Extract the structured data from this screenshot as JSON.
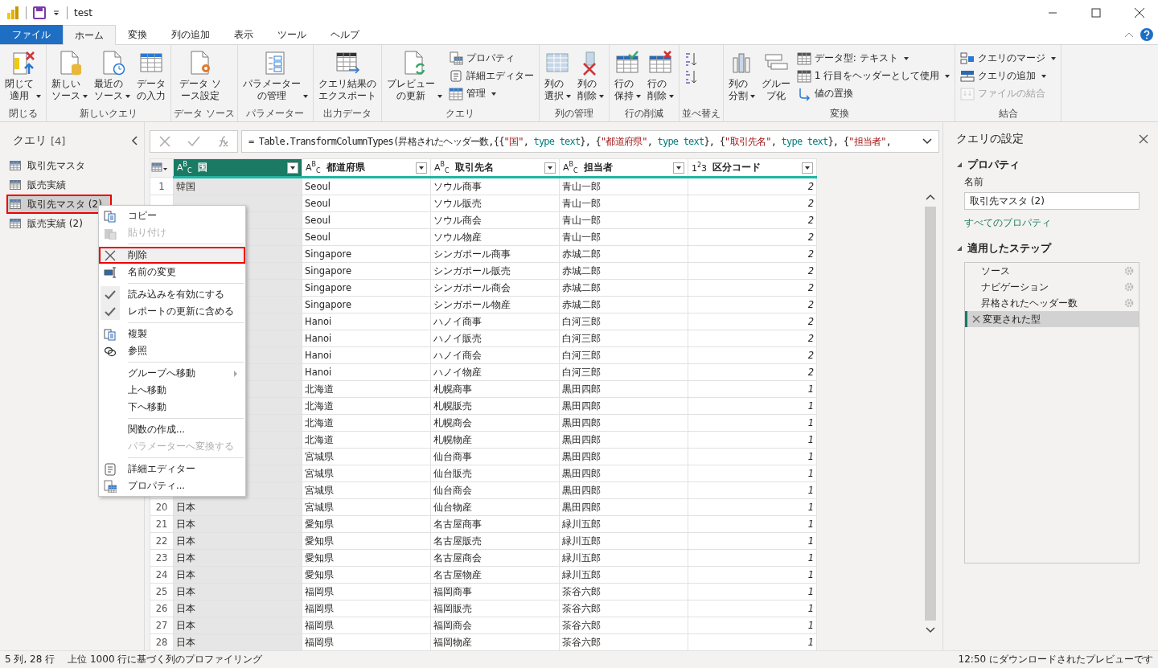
{
  "window": {
    "title": "test"
  },
  "tabs": [
    {
      "label": "ファイル",
      "kind": "file",
      "selected": false
    },
    {
      "label": "ホーム",
      "kind": "tab",
      "selected": true
    },
    {
      "label": "変換",
      "kind": "tab",
      "selected": false
    },
    {
      "label": "列の追加",
      "kind": "tab",
      "selected": false
    },
    {
      "label": "表示",
      "kind": "tab",
      "selected": false
    },
    {
      "label": "ツール",
      "kind": "tab",
      "selected": false
    },
    {
      "label": "ヘルプ",
      "kind": "tab",
      "selected": false
    }
  ],
  "ribbon": [
    {
      "label": "閉じる",
      "items": [
        {
          "kind": "large",
          "label": "閉じて適用",
          "menu": true
        }
      ]
    },
    {
      "label": "新しいクエリ",
      "items": [
        {
          "kind": "large",
          "label": "新しいソース",
          "menu": true
        },
        {
          "kind": "large",
          "label": "最近のソース",
          "menu": true
        },
        {
          "kind": "large",
          "label": "データの入力",
          "menu": false
        }
      ]
    },
    {
      "label": "データ ソース",
      "items": [
        {
          "kind": "large",
          "label": "データ ソース設定",
          "menu": false
        }
      ]
    },
    {
      "label": "パラメーター",
      "items": [
        {
          "kind": "large",
          "label": "パラメーターの管理",
          "menu": true
        }
      ]
    },
    {
      "label": "出力データ",
      "items": [
        {
          "kind": "large",
          "label": "クエリ結果のエクスポート",
          "menu": false
        }
      ]
    },
    {
      "label": "クエリ",
      "items": [
        {
          "kind": "large",
          "label": "プレビューの更新",
          "menu": true
        },
        {
          "kind": "stack",
          "items": [
            {
              "label": "プロパティ",
              "menu": false,
              "disabled": false
            },
            {
              "label": "詳細エディター",
              "menu": false,
              "disabled": false
            },
            {
              "label": "管理",
              "menu": true,
              "disabled": false
            }
          ]
        }
      ]
    },
    {
      "label": "列の管理",
      "items": [
        {
          "kind": "large",
          "label": "列の選択",
          "menu": true
        },
        {
          "kind": "large",
          "label": "列の削除",
          "menu": true
        }
      ]
    },
    {
      "label": "行の削減",
      "items": [
        {
          "kind": "large",
          "label": "行の保持",
          "menu": true
        },
        {
          "kind": "large",
          "label": "行の削除",
          "menu": true
        }
      ]
    },
    {
      "label": "並べ替え",
      "items": [
        {
          "kind": "stack",
          "items": [
            {
              "menu": false,
              "disabled": false
            },
            {
              "menu": false,
              "disabled": false
            }
          ]
        }
      ]
    },
    {
      "label": "変換",
      "items": [
        {
          "kind": "large",
          "label": "列の分割",
          "menu": true
        },
        {
          "kind": "large",
          "label": "グループ化",
          "menu": false
        },
        {
          "kind": "stack",
          "items": [
            {
              "label": "データ型: テキスト",
              "menu": true,
              "disabled": false
            },
            {
              "label": "1 行目をヘッダーとして使用",
              "menu": true,
              "disabled": false
            },
            {
              "label": "値の置換",
              "menu": false,
              "disabled": false
            }
          ]
        }
      ]
    },
    {
      "label": "結合",
      "items": [
        {
          "kind": "stack",
          "items": [
            {
              "label": "クエリのマージ",
              "menu": true,
              "disabled": false
            },
            {
              "label": "クエリの追加",
              "menu": true,
              "disabled": false
            },
            {
              "label": "ファイルの結合",
              "menu": false,
              "disabled": true
            }
          ]
        }
      ]
    }
  ],
  "queries": {
    "title": "クエリ",
    "count": "[4]",
    "items": [
      {
        "label": "取引先マスタ",
        "selected": false,
        "highlighted": false
      },
      {
        "label": "販売実績",
        "selected": false,
        "highlighted": false
      },
      {
        "label": "取引先マスタ (2)",
        "selected": true,
        "highlighted": true
      },
      {
        "label": "販売実績 (2)",
        "selected": false,
        "highlighted": false
      }
    ]
  },
  "formula": [
    {
      "kind": "plain",
      "text": "= Table.TransformColumnTypes(昇格されたヘッダー数,{{"
    },
    {
      "kind": "string",
      "text": "\"国\""
    },
    {
      "kind": "plain",
      "text": ", "
    },
    {
      "kind": "keyword",
      "text": "type text"
    },
    {
      "kind": "plain",
      "text": "}, {"
    },
    {
      "kind": "string",
      "text": "\"都道府県\""
    },
    {
      "kind": "plain",
      "text": ", "
    },
    {
      "kind": "keyword",
      "text": "type text"
    },
    {
      "kind": "plain",
      "text": "}, {"
    },
    {
      "kind": "string",
      "text": "\"取引先名\""
    },
    {
      "kind": "plain",
      "text": ", "
    },
    {
      "kind": "keyword",
      "text": "type text"
    },
    {
      "kind": "plain",
      "text": "}, {"
    },
    {
      "kind": "string",
      "text": "\"担当者\""
    },
    {
      "kind": "plain",
      "text": ", "
    }
  ],
  "table": {
    "columns": [
      {
        "type": "A$^{B}$$_{C}$",
        "label": "国",
        "selected": true
      },
      {
        "type": "A$^{B}$$_{C}$",
        "label": "都道府県",
        "selected": false
      },
      {
        "type": "A$^{B}$$_{C}$",
        "label": "取引先名",
        "selected": false
      },
      {
        "type": "A$^{B}$$_{C}$",
        "label": "担当者",
        "selected": false
      },
      {
        "type": "1$^{2}$3",
        "label": "区分コード",
        "selected": false
      }
    ],
    "rows": [
      {
        "number": "1",
        "cells": [
          "韓国",
          "Seoul",
          "ソウル商事",
          "青山一郎",
          "2"
        ]
      },
      {
        "cells": [
          "",
          "Seoul",
          "ソウル販売",
          "青山一郎",
          "2"
        ]
      },
      {
        "cells": [
          "",
          "Seoul",
          "ソウル商会",
          "青山一郎",
          "2"
        ]
      },
      {
        "cells": [
          "",
          "Seoul",
          "ソウル物産",
          "青山一郎",
          "2"
        ]
      },
      {
        "cells": [
          "",
          "Singapore",
          "シンガポール商事",
          "赤城二郎",
          "2"
        ]
      },
      {
        "cells": [
          "",
          "Singapore",
          "シンガポール販売",
          "赤城二郎",
          "2"
        ]
      },
      {
        "cells": [
          "",
          "Singapore",
          "シンガポール商会",
          "赤城二郎",
          "2"
        ]
      },
      {
        "cells": [
          "",
          "Singapore",
          "シンガポール物産",
          "赤城二郎",
          "2"
        ]
      },
      {
        "cells": [
          "",
          "Hanoi",
          "ハノイ商事",
          "白河三郎",
          "2"
        ]
      },
      {
        "cells": [
          "",
          "Hanoi",
          "ハノイ販売",
          "白河三郎",
          "2"
        ]
      },
      {
        "cells": [
          "",
          "Hanoi",
          "ハノイ商会",
          "白河三郎",
          "2"
        ]
      },
      {
        "cells": [
          "",
          "Hanoi",
          "ハノイ物産",
          "白河三郎",
          "2"
        ]
      },
      {
        "cells": [
          "",
          "北海道",
          "札幌商事",
          "黒田四郎",
          "1"
        ]
      },
      {
        "cells": [
          "",
          "北海道",
          "札幌販売",
          "黒田四郎",
          "1"
        ]
      },
      {
        "cells": [
          "",
          "北海道",
          "札幌商会",
          "黒田四郎",
          "1"
        ]
      },
      {
        "cells": [
          "",
          "北海道",
          "札幌物産",
          "黒田四郎",
          "1"
        ]
      },
      {
        "cells": [
          "",
          "宮城県",
          "仙台商事",
          "黒田四郎",
          "1"
        ]
      },
      {
        "cells": [
          "",
          "宮城県",
          "仙台販売",
          "黒田四郎",
          "1"
        ]
      },
      {
        "cells": [
          "",
          "宮城県",
          "仙台商会",
          "黒田四郎",
          "1"
        ]
      },
      {
        "number": "20",
        "cells": [
          "日本",
          "宮城県",
          "仙台物産",
          "黒田四郎",
          "1"
        ]
      },
      {
        "number": "21",
        "cells": [
          "日本",
          "愛知県",
          "名古屋商事",
          "緑川五郎",
          "1"
        ]
      },
      {
        "number": "22",
        "cells": [
          "日本",
          "愛知県",
          "名古屋販売",
          "緑川五郎",
          "1"
        ]
      },
      {
        "number": "23",
        "cells": [
          "日本",
          "愛知県",
          "名古屋商会",
          "緑川五郎",
          "1"
        ]
      },
      {
        "number": "24",
        "cells": [
          "日本",
          "愛知県",
          "名古屋物産",
          "緑川五郎",
          "1"
        ]
      },
      {
        "number": "25",
        "cells": [
          "日本",
          "福岡県",
          "福岡商事",
          "茶谷六郎",
          "1"
        ]
      },
      {
        "number": "26",
        "cells": [
          "日本",
          "福岡県",
          "福岡販売",
          "茶谷六郎",
          "1"
        ]
      },
      {
        "number": "27",
        "cells": [
          "日本",
          "福岡県",
          "福岡商会",
          "茶谷六郎",
          "1"
        ]
      },
      {
        "number": "28",
        "cells": [
          "日本",
          "福岡県",
          "福岡物産",
          "茶谷六郎",
          "1"
        ]
      }
    ]
  },
  "context_menu": [
    {
      "kind": "item",
      "label": "コピー",
      "disabled": false,
      "highlighted": false
    },
    {
      "kind": "item",
      "label": "貼り付け",
      "disabled": true,
      "highlighted": false
    },
    {
      "kind": "separator"
    },
    {
      "kind": "item",
      "label": "削除",
      "disabled": false,
      "highlighted": true
    },
    {
      "kind": "item",
      "label": "名前の変更",
      "disabled": false,
      "highlighted": false
    },
    {
      "kind": "separator"
    },
    {
      "kind": "check",
      "label": "読み込みを有効にする",
      "checked": true,
      "disabled": false,
      "highlighted": false
    },
    {
      "kind": "check",
      "label": "レポートの更新に含める",
      "checked": true,
      "disabled": false,
      "highlighted": false
    },
    {
      "kind": "separator"
    },
    {
      "kind": "item",
      "label": "複製",
      "disabled": false,
      "highlighted": false
    },
    {
      "kind": "item",
      "label": "参照",
      "disabled": false,
      "highlighted": false
    },
    {
      "kind": "separator"
    },
    {
      "kind": "submenu",
      "label": "グループへ移動",
      "disabled": false,
      "highlighted": false
    },
    {
      "kind": "item",
      "label": "上へ移動",
      "disabled": false,
      "highlighted": false
    },
    {
      "kind": "item",
      "label": "下へ移動",
      "disabled": false,
      "highlighted": false
    },
    {
      "kind": "separator"
    },
    {
      "kind": "item",
      "label": "関数の作成...",
      "disabled": false,
      "highlighted": false
    },
    {
      "kind": "item",
      "label": "パラメーターへ変換する",
      "disabled": true,
      "highlighted": false
    },
    {
      "kind": "separator"
    },
    {
      "kind": "item",
      "label": "詳細エディター",
      "disabled": false,
      "highlighted": false
    },
    {
      "kind": "item",
      "label": "プロパティ...",
      "disabled": false,
      "highlighted": false
    }
  ],
  "settings": {
    "title": "クエリの設定",
    "properties_heading": "プロパティ",
    "name_label": "名前",
    "name_value": "取引先マスタ (2)",
    "all_properties_link": "すべてのプロパティ",
    "steps_heading": "適用したステップ",
    "steps": [
      {
        "label": "ソース",
        "selected": false,
        "settings": true
      },
      {
        "label": "ナビゲーション",
        "selected": false,
        "settings": true
      },
      {
        "label": "昇格されたヘッダー数",
        "selected": false,
        "settings": true
      },
      {
        "label": "変更された型",
        "selected": true,
        "settings": false
      }
    ]
  },
  "status_bar": {
    "summary": "5 列, 28 行",
    "profiling": "上位 1000 行に基づく列のプロファイリング",
    "preview": "12:50 にダウンロードされたプレビューです"
  }
}
